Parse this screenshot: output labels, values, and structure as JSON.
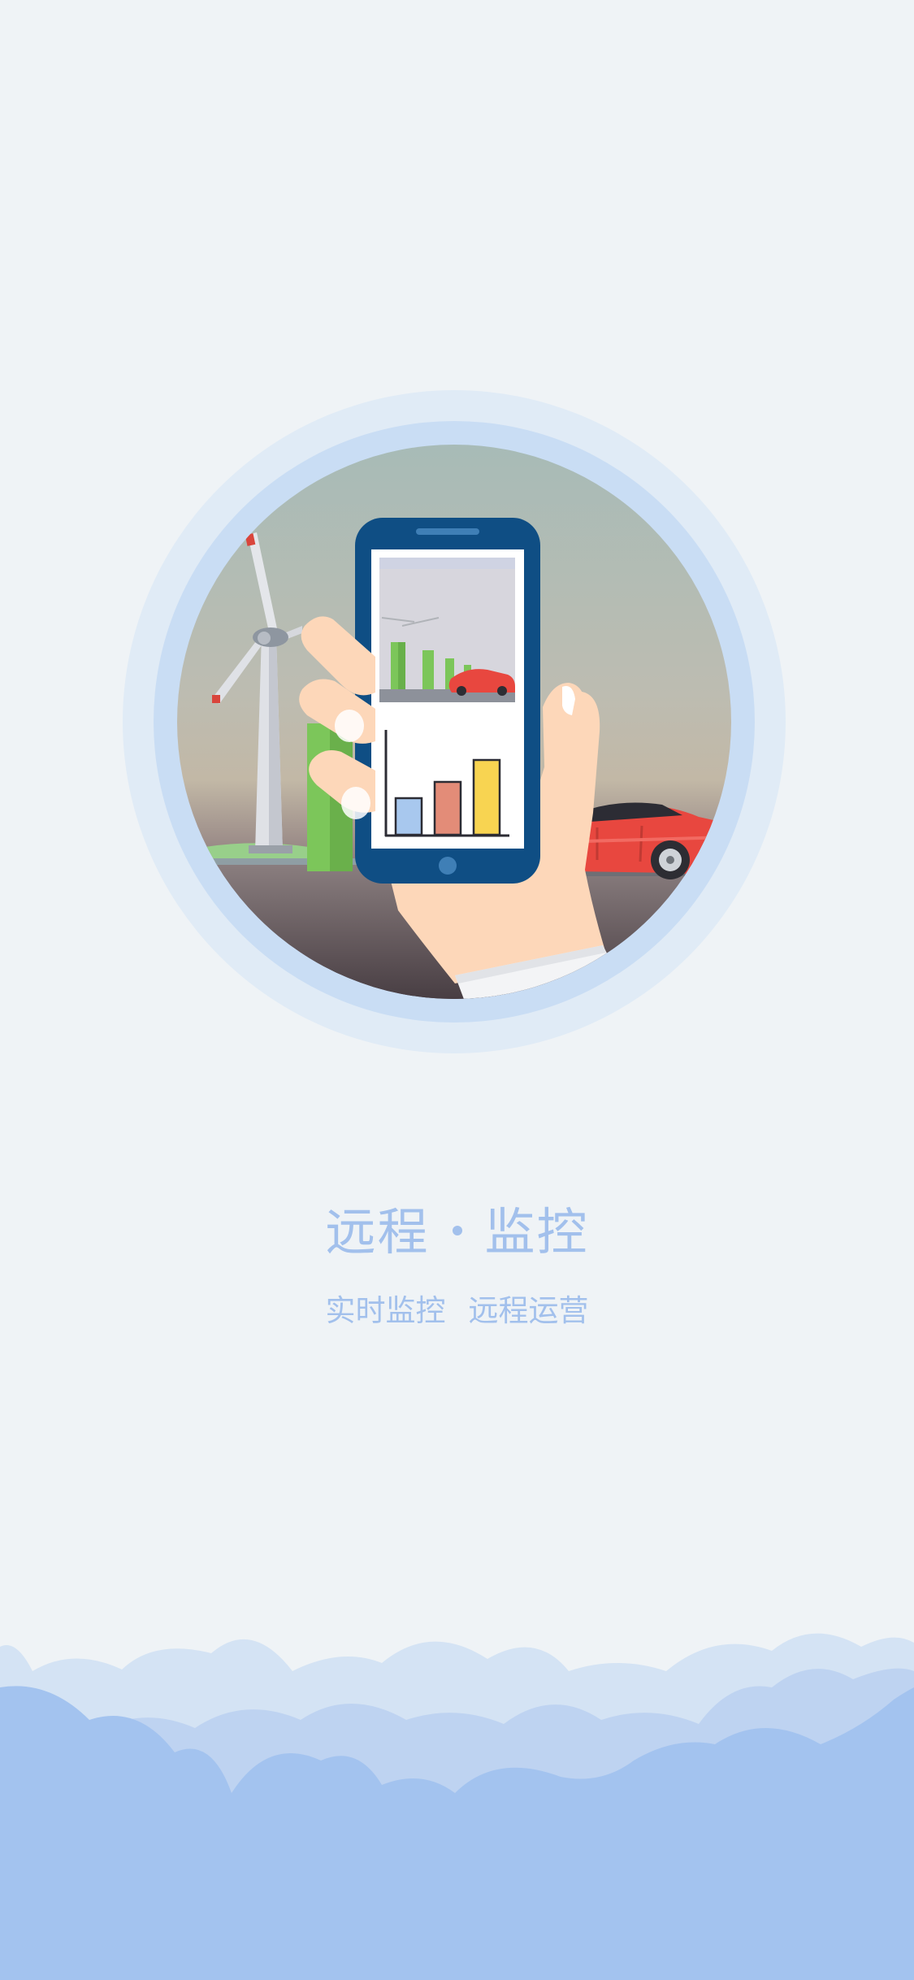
{
  "headline": {
    "left": "远程",
    "right": "监控"
  },
  "subline": {
    "left": "实时监控",
    "right": "远程运营"
  },
  "colors": {
    "background": "#eff3f6",
    "accent_text": "#a2c0ec",
    "cloud_front": "#a3c3ef",
    "cloud_mid": "#bed3f1",
    "cloud_back": "#d4e3f4",
    "phone_frame": "#0f4e84",
    "car": "#e8473f",
    "charger": "#7cc65a"
  },
  "illustration": {
    "phone_chart": {
      "type": "bar",
      "values": [
        3,
        4,
        5
      ],
      "colors": [
        "#a8c8ee",
        "#e38c78",
        "#f8d451"
      ]
    }
  }
}
